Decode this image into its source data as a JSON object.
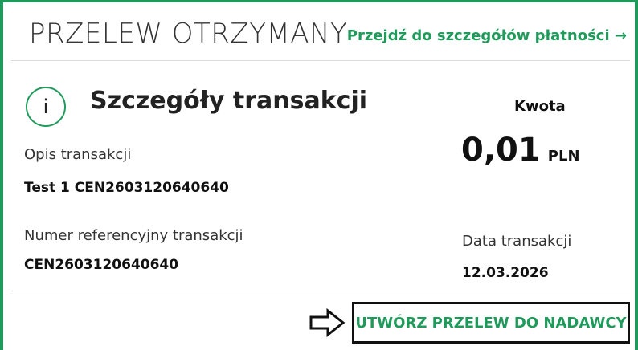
{
  "header": {
    "title": "PRZELEW OTRZYMANY",
    "details_link": "Przejdź do szczegółów płatności →"
  },
  "section": {
    "icon": "info-icon",
    "icon_glyph": "i",
    "title": "Szczegóły transakcji"
  },
  "fields": {
    "description_label": "Opis transakcji",
    "description_value": "Test 1 CEN2603120640640",
    "reference_label": "Numer referencyjny transakcji",
    "reference_value": "CEN2603120640640",
    "date_label": "Data transakcji",
    "date_value": "12.03.2026"
  },
  "amount": {
    "label": "Kwota",
    "value": "0,01",
    "currency": "PLN"
  },
  "actions": {
    "create_transfer_label": "UTWÓRZ PRZELEW DO NADAWCY",
    "pointer_icon": "arrow-right-outline-icon"
  },
  "colors": {
    "accent": "#1f9a5b",
    "text": "#1a1a1a",
    "divider": "#dcdcdc"
  }
}
